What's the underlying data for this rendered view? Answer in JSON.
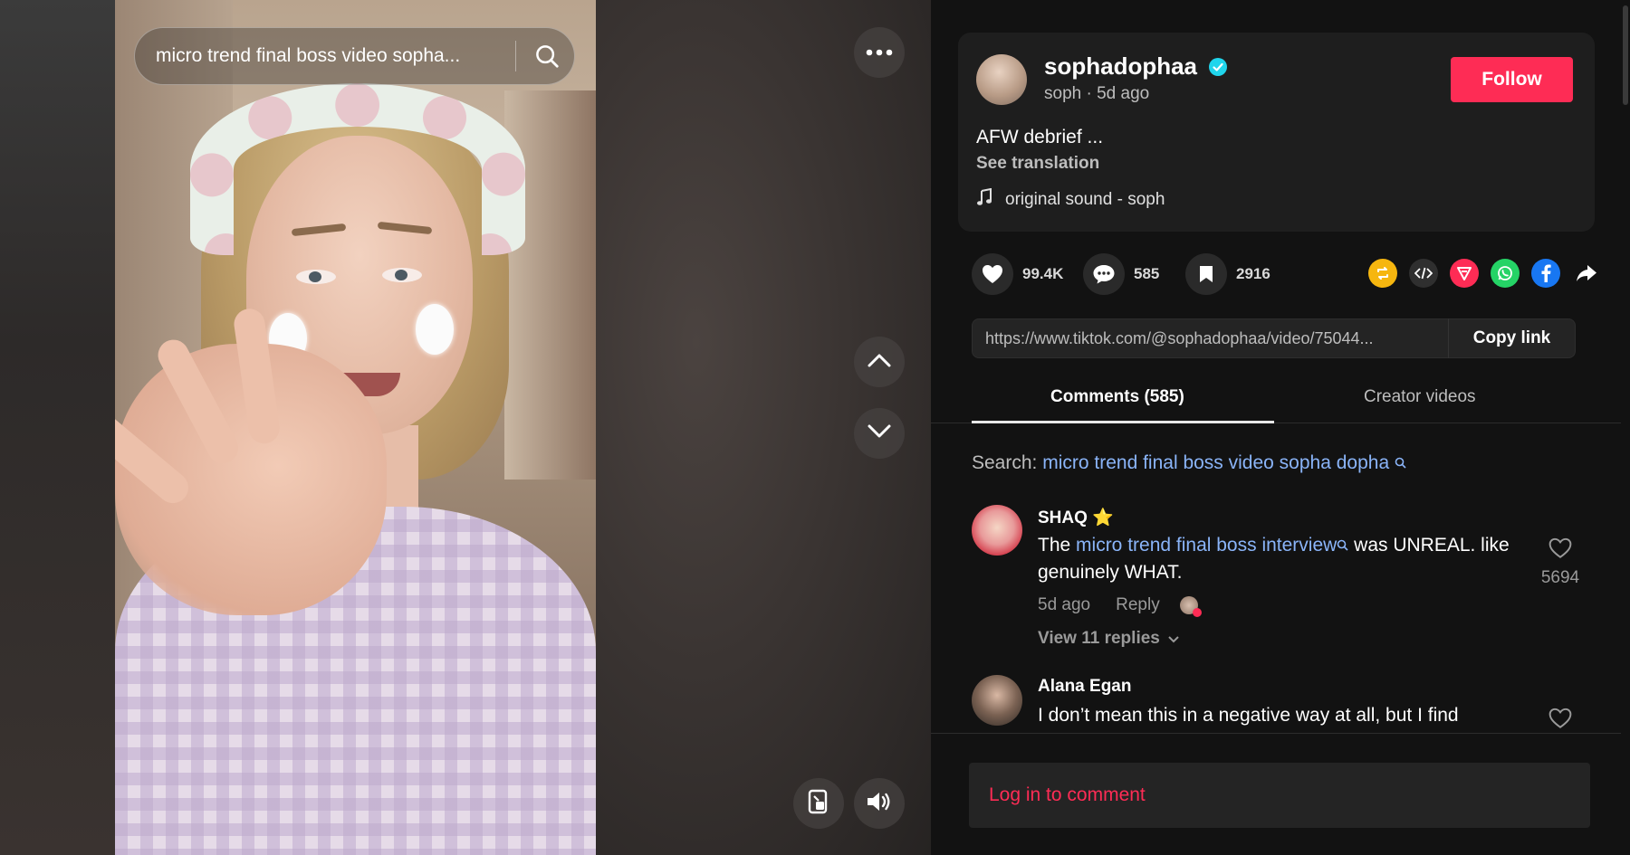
{
  "video": {
    "search_query": "micro trend final boss video sopha...",
    "icons": {
      "search": "search-icon",
      "more": "ellipsis-icon",
      "prev": "chevron-up-icon",
      "next": "chevron-down-icon",
      "pip": "picture-in-picture-icon",
      "volume": "volume-icon"
    }
  },
  "post": {
    "username": "sophadophaa",
    "verified": true,
    "nickname": "soph",
    "time_ago": "5d ago",
    "subline": "soph · 5d ago",
    "follow_label": "Follow",
    "caption": "AFW debrief ...",
    "see_translation": "See translation",
    "music": "original sound - soph"
  },
  "stats": {
    "likes": "99.4K",
    "comments": "585",
    "saves": "2916"
  },
  "share_icons": [
    "repost-icon",
    "embed-icon",
    "send-icon",
    "whatsapp-icon",
    "facebook-icon",
    "share-arrow-icon"
  ],
  "link": {
    "url": "https://www.tiktok.com/@sophadophaa/video/75044...",
    "copy_label": "Copy link"
  },
  "tabs": {
    "comments": "Comments (585)",
    "creator_videos": "Creator videos"
  },
  "search_suggestion": {
    "prefix": "Search: ",
    "query": "micro trend final boss video sopha dopha"
  },
  "comments": [
    {
      "name": "SHAQ",
      "badge": "⭐",
      "text_before": "The ",
      "text_link": "micro trend final boss interview",
      "text_after": " was UNREAL. like genuinely WHAT.",
      "time": "5d ago",
      "reply_label": "Reply",
      "likes": "5694",
      "view_replies": "View 11 replies"
    },
    {
      "name": "Alana Egan",
      "text": "I don’t mean this in a negative way at all, but I find"
    }
  ],
  "login_label": "Log in to comment",
  "colors": {
    "accent": "#fe2c55",
    "link": "#8ab4f8",
    "panel_bg": "#121212",
    "card_bg": "#1e1e1e"
  }
}
